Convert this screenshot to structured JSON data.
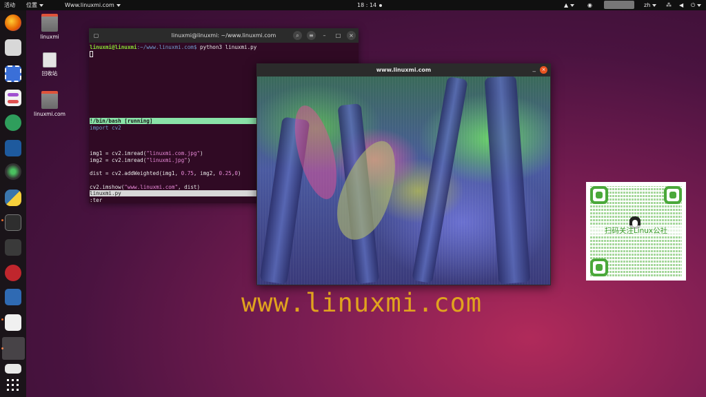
{
  "topbar": {
    "activities": "活动",
    "places": "位置",
    "app_menu": "Www.linuxmi.com",
    "clock": "18 : 14",
    "language": "zh"
  },
  "desktop": {
    "icons": [
      {
        "label": "linuxmi"
      },
      {
        "label": "回收站"
      },
      {
        "label": "linuxmi.com"
      }
    ]
  },
  "terminal": {
    "title": "linuxmi@linuxmi: ~/www.linuxmi.com",
    "prompt_user": "linuxmi@linuxmi",
    "prompt_path": ":~/www.linuxmi.com$",
    "prompt_cmd": " python3 linuxmi.py",
    "status": "!/bin/bash [running]",
    "code": {
      "l1": "import cv2",
      "l2a": "img1 = cv2.imread(",
      "l2s": "\"linuxmi.com.jpg\"",
      "l2b": ")",
      "l3a": "img2 = cv2.imread(",
      "l3s": "\"linuxmi.jpg\"",
      "l3b": ")",
      "l4a": "dist = cv2.addWeighted(img1, ",
      "l4n1": "0.75",
      "l4m": ", img2, ",
      "l4n2": "0.25",
      "l4c": ",",
      "l4n3": "0",
      "l4b": ")",
      "l5a": "cv2.imshow(",
      "l5s": "\"www.linuxmi.com\"",
      "l5b": ", dist)"
    },
    "file_line": "linuxmi.py",
    "cmd_line": ":ter"
  },
  "image_window": {
    "title": "www.linuxmi.com",
    "minimize": "_",
    "close": "×"
  },
  "watermark": "www.linuxmi.com",
  "qr": {
    "label": "扫码关注Linux公社"
  },
  "colors": {
    "ubuntu_orange": "#e95420",
    "terminal_bg": "#300a24",
    "watermark": "#e0a31e"
  }
}
